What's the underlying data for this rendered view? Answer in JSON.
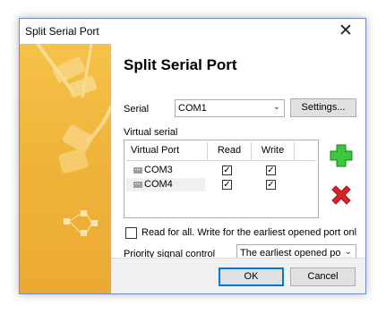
{
  "window": {
    "title": "Split Serial Port",
    "close_icon": "close-icon"
  },
  "heading": "Split Serial Port",
  "serial": {
    "label": "Serial",
    "value": "COM1",
    "settings_label": "Settings..."
  },
  "virtual_serial": {
    "label": "Virtual serial",
    "columns": [
      "Virtual Port",
      "Read",
      "Write"
    ],
    "rows": [
      {
        "port": "COM3",
        "read": true,
        "write": true
      },
      {
        "port": "COM4",
        "read": true,
        "write": true
      }
    ],
    "add_icon": "plus-icon",
    "remove_icon": "delete-icon"
  },
  "read_for_all": {
    "label": "Read for all. Write for the earliest opened port onl",
    "checked": false
  },
  "priority": {
    "label": "Priority signal control",
    "value": "The earliest opened po"
  },
  "footer": {
    "ok_label": "OK",
    "cancel_label": "Cancel"
  },
  "colors": {
    "banner": "#f0b43a",
    "add": "#2db52d",
    "remove": "#d9232b",
    "focus": "#0078d7"
  }
}
